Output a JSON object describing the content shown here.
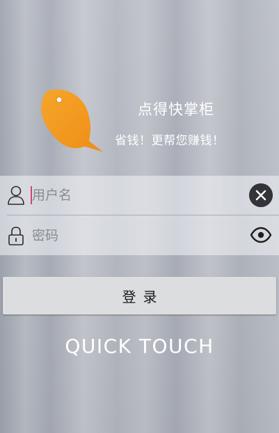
{
  "app": {
    "name": "点得快掌柜",
    "slogan": "省钱！更帮您赚钱！"
  },
  "form": {
    "username": {
      "placeholder": "用户名",
      "value": "",
      "leading_icon": "user-icon",
      "trailing_icon": "clear-icon"
    },
    "password": {
      "placeholder": "密码",
      "value": "",
      "leading_icon": "lock-icon",
      "trailing_icon": "eye-icon"
    }
  },
  "login_button": {
    "label": "登录"
  },
  "brand_text": "QUICK TOUCH",
  "colors": {
    "logo_orange": "#f39a1d",
    "caret": "#d0437a",
    "button_bg": "#dcdddf",
    "clear_bg": "#333438",
    "text_white": "#ffffff"
  }
}
